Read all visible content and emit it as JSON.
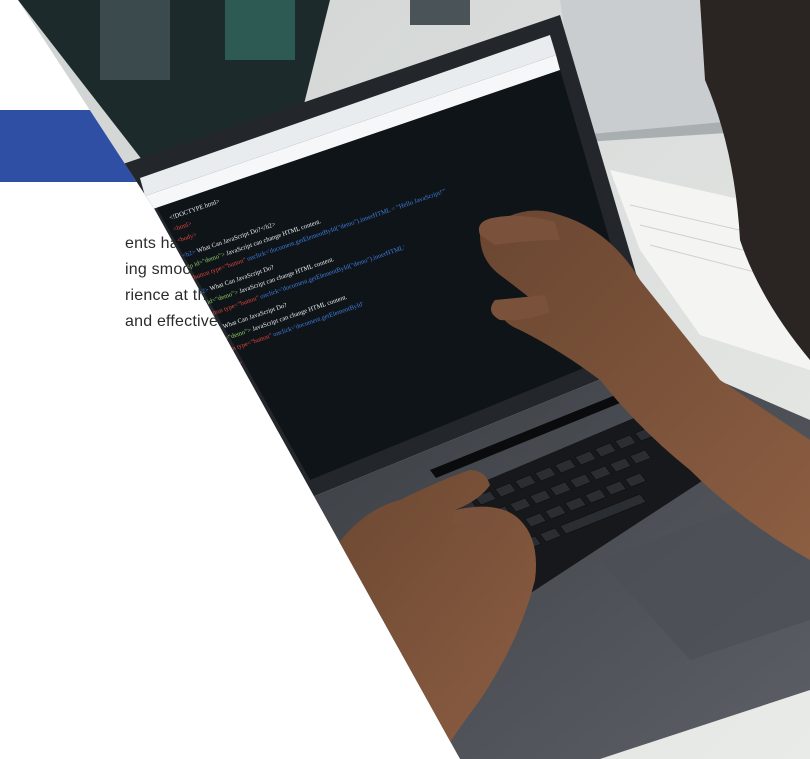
{
  "content": {
    "lines": [
      "ents have",
      "ing smooth",
      "rience at the",
      "and effectively"
    ]
  },
  "photo": {
    "subject": "laptop-with-code-and-hands",
    "code_lines": [
      "<!DOCTYPE html>",
      "<html>",
      "<body>",
      "<h2>What Can JavaScript Do?</h2>",
      "<p id=\"demo\">JavaScript can change HTML content.</p>",
      "<button type=\"button\" onclick=\"document.getElementById('demo').innerHTML = 'Hello JavaScript!'\">Click Me!</button>",
      "<h2>What Can JavaScript Do?</h2>",
      "<p id=\"demo\">JavaScript can change HTML content.</p>",
      "<button type=\"button\" onclick=\"document.getElementById('demo').innerHTML = 'Hello JavaScript!'\">Click Me!</button>",
      "<h2>What Can JavaScript Do?</h2>",
      "<p id=\"demo\">JavaScript can change HTML content.</p>",
      "<button type=\"button\" onclick=\"document.getElementById('demo').innerHTML = 'Hello JavaScript!'\">Click Me!</button>",
      "</body>",
      "</html>"
    ]
  },
  "colors": {
    "accent_blue": "#2f4fa5",
    "screen_bg": "#0f1418",
    "code_red": "#e2463f",
    "code_blue": "#3f7fe0",
    "code_green": "#8fd16a",
    "code_white": "#e8ecef"
  }
}
